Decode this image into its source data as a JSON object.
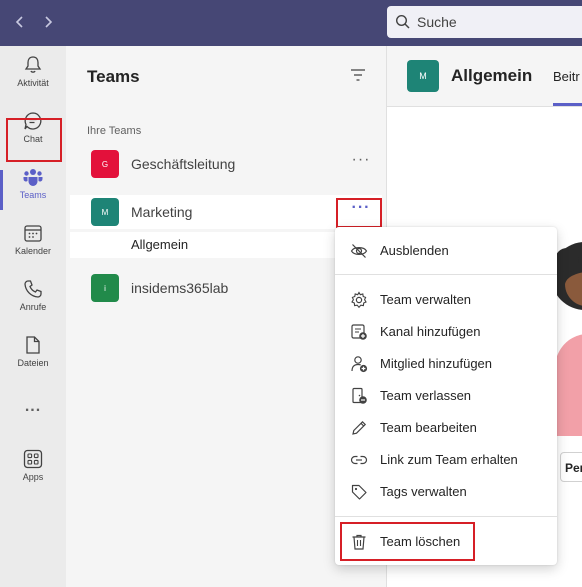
{
  "search": {
    "label": "Suche"
  },
  "rail": {
    "items": [
      {
        "label": "Aktivität",
        "icon": "bell-icon"
      },
      {
        "label": "Chat",
        "icon": "chat-icon"
      },
      {
        "label": "Teams",
        "icon": "teams-icon"
      },
      {
        "label": "Kalender",
        "icon": "calendar-icon"
      },
      {
        "label": "Anrufe",
        "icon": "phone-icon"
      },
      {
        "label": "Dateien",
        "icon": "file-icon"
      },
      {
        "label": "Apps",
        "icon": "apps-icon"
      }
    ],
    "more": "..."
  },
  "panel": {
    "title": "Teams",
    "section": "Ihre Teams",
    "teams": [
      {
        "name": "Geschäftsleitung",
        "initial": "G",
        "color": "#e3113b"
      },
      {
        "name": "Marketing",
        "initial": "M",
        "color": "#1e8476"
      },
      {
        "name": "insidems365lab",
        "initial": "i",
        "color": "#218a4a"
      }
    ],
    "channel": "Allgemein",
    "more": "···"
  },
  "right": {
    "avatar_initial": "M",
    "title": "Allgemein",
    "tab": "Beitr",
    "button_partial": "Per"
  },
  "menu": {
    "items": [
      {
        "label": "Ausblenden",
        "icon": "eye-off-icon"
      },
      {
        "label": "Team verwalten",
        "icon": "gear-icon"
      },
      {
        "label": "Kanal hinzufügen",
        "icon": "add-channel-icon"
      },
      {
        "label": "Mitglied hinzufügen",
        "icon": "add-person-icon"
      },
      {
        "label": "Team verlassen",
        "icon": "leave-icon"
      },
      {
        "label": "Team bearbeiten",
        "icon": "pencil-icon"
      },
      {
        "label": "Link zum Team erhalten",
        "icon": "link-icon"
      },
      {
        "label": "Tags verwalten",
        "icon": "tag-icon"
      },
      {
        "label": "Team löschen",
        "icon": "trash-icon"
      }
    ]
  },
  "colors": {
    "accent": "#5b5fc7",
    "topbar": "#464775",
    "highlight": "#d61f26"
  }
}
